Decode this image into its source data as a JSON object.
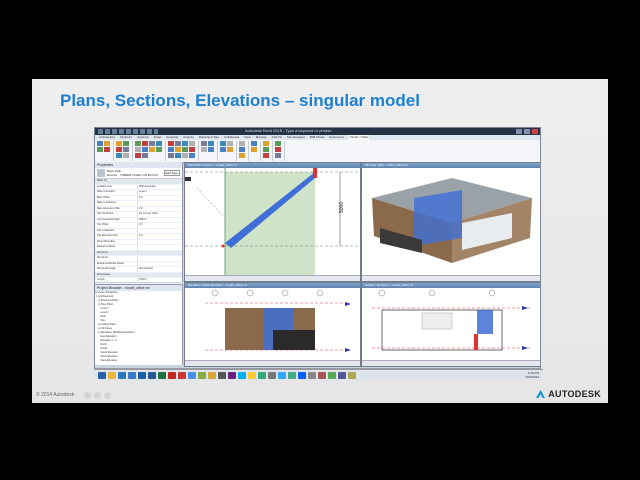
{
  "slide": {
    "title": "Plans, Sections, Elevations – singular model",
    "copyright": "© 2014 Autodesk",
    "brand": "AUTODESK",
    "accent": "#1e7fd0"
  },
  "app": {
    "title": "Autodesk Revit 2015 - Type a keyword or phrase",
    "tabs": [
      "Architecture",
      "Structure",
      "Systems",
      "Insert",
      "Annotate",
      "Analyze",
      "Massing & Site",
      "Collaborate",
      "View",
      "Manage",
      "Add-Ins",
      "Site Designer",
      "BIM Model",
      "Extensions",
      "Modify | Walls"
    ],
    "active_tab": "Modify | Walls",
    "ribbon_groups": [
      "Properties",
      "Clipboard",
      "Geometry",
      "Modify",
      "View",
      "Measure",
      "Create",
      "Mode",
      "Modify Wall",
      "Wall Pad"
    ],
    "properties": {
      "header": "Properties",
      "type_line1": "Basic Wall",
      "type_line2": "Exterior - TIMBER PANEL ON BLOCK",
      "edit_type": "Edit Type",
      "rows": [
        {
          "k": "Walls (1)",
          "v": "",
          "section": true
        },
        {
          "k": "Location Line",
          "v": "Wall Centerline"
        },
        {
          "k": "Base Constraint",
          "v": "Level 1"
        },
        {
          "k": "Base Offset",
          "v": "0.0"
        },
        {
          "k": "Base is Attached",
          "v": ""
        },
        {
          "k": "Base Extension Dist.",
          "v": "0.0"
        },
        {
          "k": "Top Constraint",
          "v": "Up to level: Roof"
        },
        {
          "k": "Unconnected Height",
          "v": "3000.0"
        },
        {
          "k": "Top Offset",
          "v": "0.0"
        },
        {
          "k": "Top is Attached",
          "v": ""
        },
        {
          "k": "Top Extension Dist.",
          "v": "0.0"
        },
        {
          "k": "Room Bounding",
          "v": ""
        },
        {
          "k": "Related to Mass",
          "v": ""
        },
        {
          "k": "Structural",
          "v": "",
          "section": true
        },
        {
          "k": "Structural",
          "v": ""
        },
        {
          "k": "Enable Analytical Model",
          "v": ""
        },
        {
          "k": "Structural Usage",
          "v": "Non-bearing"
        },
        {
          "k": "Dimensions",
          "v": "",
          "section": true
        },
        {
          "k": "Length",
          "v": "7000.0"
        },
        {
          "k": "Area",
          "v": "21.000 m²"
        },
        {
          "k": "Volume",
          "v": "6.300 m³"
        },
        {
          "k": "Identity Data",
          "v": "",
          "section": true
        },
        {
          "k": "Image",
          "v": ""
        },
        {
          "k": "Comments",
          "v": ""
        },
        {
          "k": "Mark",
          "v": ""
        },
        {
          "k": "Phasing",
          "v": "",
          "section": true
        }
      ]
    },
    "browser": {
      "header": "Project Browser - model_office.rvt",
      "items": [
        "[-] Views (Discipline)",
        "  [-] Architectural",
        "    [-] Structural Plans",
        "    [-] Floor Plans",
        "        Level 1",
        "        Level 2",
        "        Roof",
        "        Site",
        "    [+] Ceiling Plans",
        "    [+] 3D Views",
        "    [-] Elevations (Building Elevation)",
        "        East Elevation",
        "        Elevation 1 - a",
        "        North",
        "        South",
        "        South Elevation",
        "        North Elevation",
        "        West Elevation",
        "    [+] Sections"
      ]
    },
    "viewports": [
      {
        "title": "Floor Plan: Level 1 - model_office.rvt",
        "dim": "5000"
      },
      {
        "title": "3D View: {3D} - model_office.rvt"
      },
      {
        "title": "Elevation: South Elevation - model_office.rvt"
      },
      {
        "title": "Section: Section 1 - model_office.rvt"
      }
    ],
    "scale": "1 : 100",
    "status_text": "Click to select, TAB for alternates, CTRL adds, SHIFT unselects.",
    "clock_time": "2:49 PM",
    "clock_date": "3/03/2014"
  },
  "colors": {
    "wall_blue": "#3f6fd6",
    "timber": "#8a6a4a",
    "plan_green": "#cfe3c8",
    "bubble_red": "#d33"
  },
  "taskbar_icons": [
    "start",
    "explorer",
    "revit",
    "ie",
    "outlook",
    "word",
    "excel",
    "acrobat",
    "autocad",
    "chrome",
    "paint",
    "folder",
    "media",
    "vs",
    "skype",
    "notes",
    "maps",
    "calc",
    "photoshop",
    "navis",
    "dropbox",
    "other",
    "other",
    "other",
    "other",
    "other"
  ]
}
